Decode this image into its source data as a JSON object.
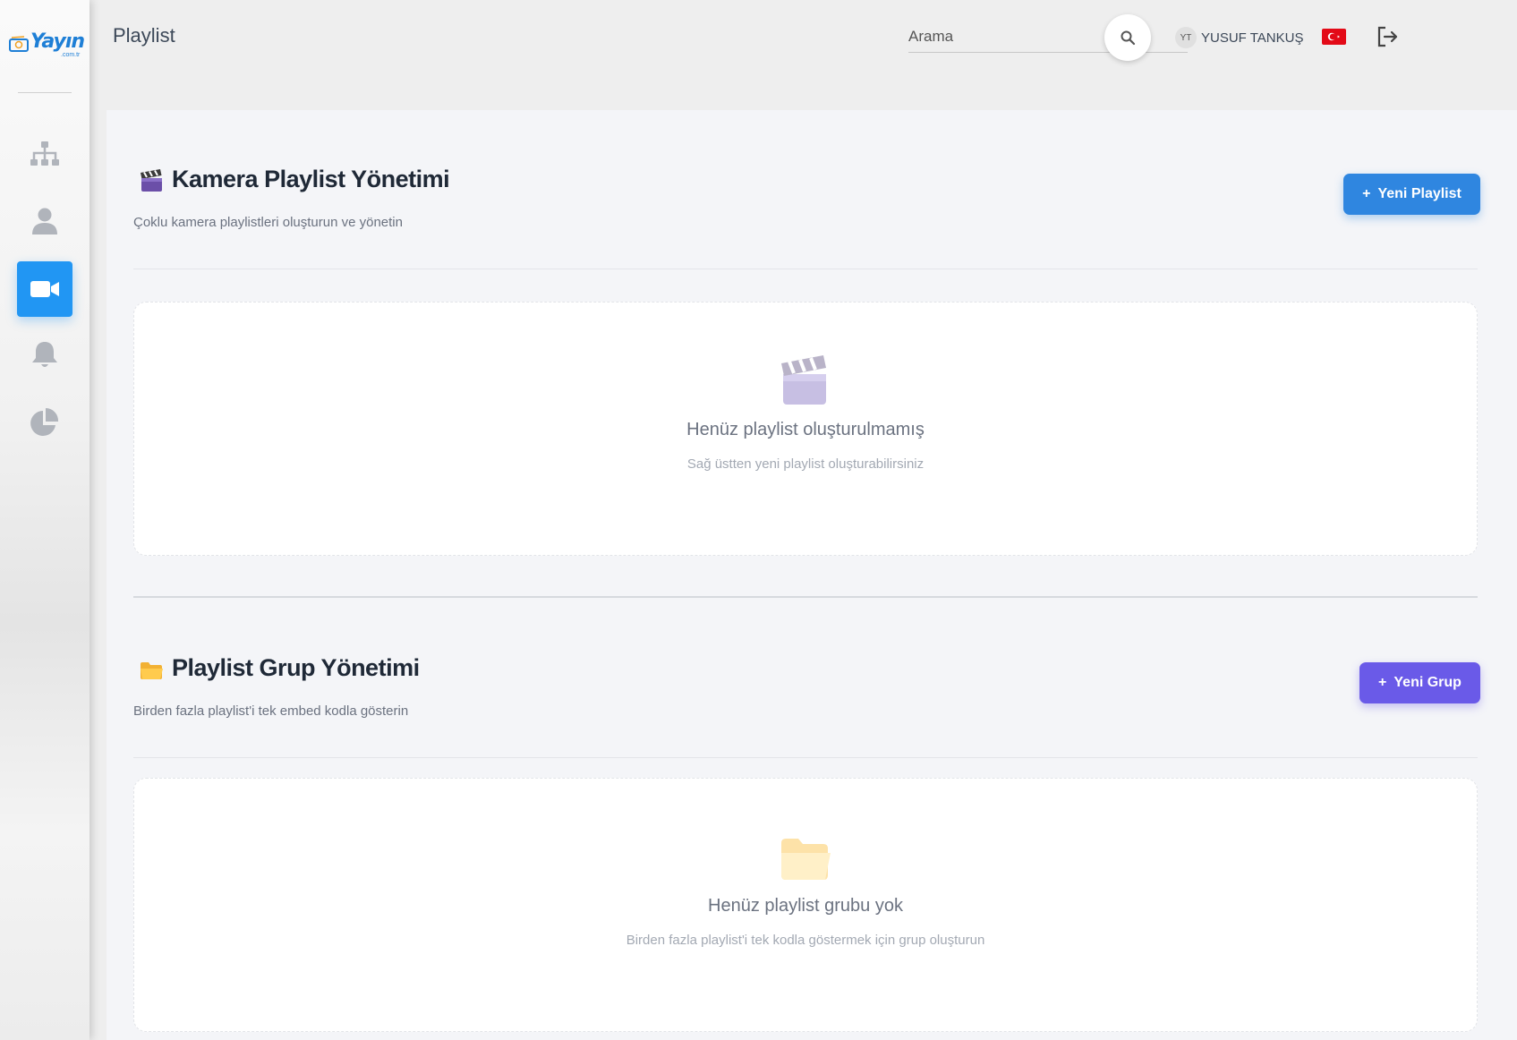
{
  "sidebar": {
    "logo": {
      "text": "Yayın",
      "sub": ".com.tr"
    },
    "items": [
      {
        "name": "sitemap",
        "icon": "sitemap-icon",
        "active": false
      },
      {
        "name": "users",
        "icon": "user-icon",
        "active": false
      },
      {
        "name": "cameras",
        "icon": "video-camera-icon",
        "active": true
      },
      {
        "name": "notifications",
        "icon": "bell-icon",
        "active": false
      },
      {
        "name": "reports",
        "icon": "pie-chart-icon",
        "active": false
      }
    ]
  },
  "header": {
    "title": "Playlist",
    "search": {
      "placeholder": "Arama",
      "value": ""
    },
    "user": {
      "initials": "YT",
      "name": "YUSUF TANKUŞ"
    },
    "language_flag": "tr-flag-icon"
  },
  "camera_section": {
    "title": "Kamera Playlist Yönetimi",
    "subtitle": "Çoklu kamera playlistleri oluşturun ve yönetin",
    "button_label": "Yeni Playlist",
    "button_plus": "+",
    "empty": {
      "title": "Henüz playlist oluşturulmamış",
      "subtitle": "Sağ üstten yeni playlist oluşturabilirsiniz"
    }
  },
  "group_section": {
    "title": "Playlist Grup Yönetimi",
    "subtitle": "Birden fazla playlist'i tek embed kodla gösterin",
    "button_label": "Yeni Grup",
    "button_plus": "+",
    "empty": {
      "title": "Henüz playlist grubu yok",
      "subtitle": "Birden fazla playlist'i tek kodla göstermek için grup oluşturun"
    }
  },
  "colors": {
    "primary_blue": "#2f86e0",
    "primary_purple": "#6a5ae8",
    "sidebar_active": "#2196f3",
    "flag_red": "#e30a17"
  }
}
